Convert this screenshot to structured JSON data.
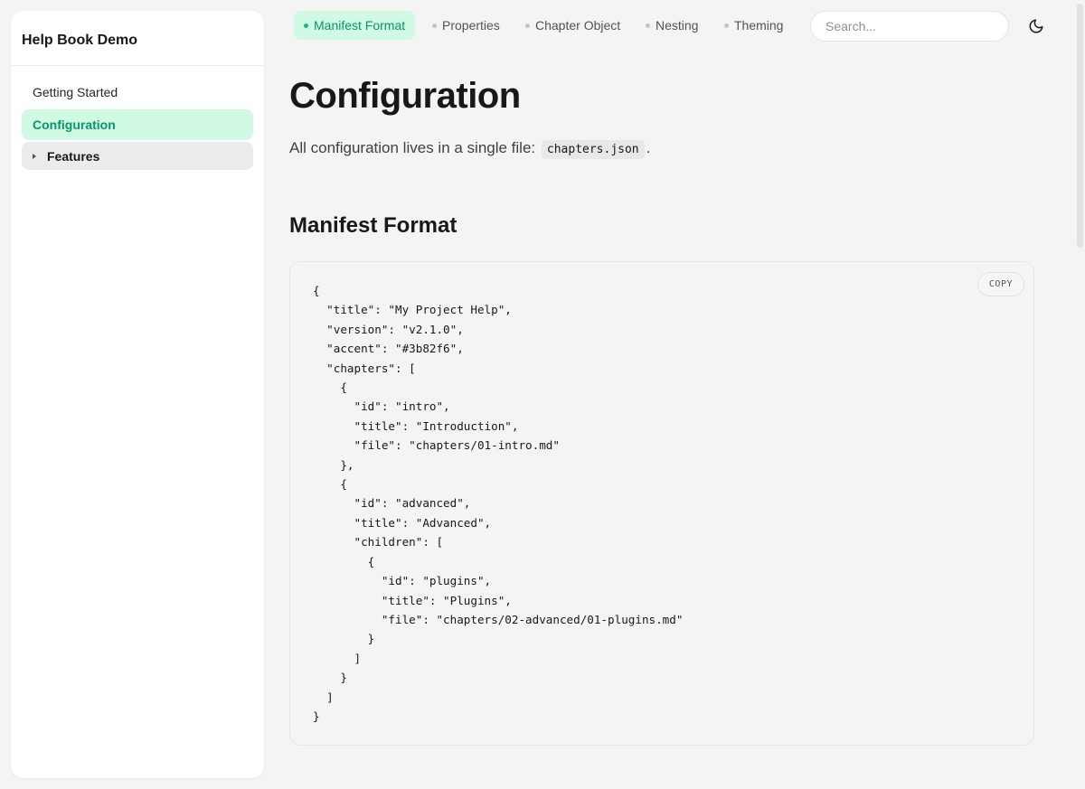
{
  "sidebar": {
    "title": "Help Book Demo",
    "items": [
      {
        "label": "Getting Started"
      },
      {
        "label": "Configuration"
      },
      {
        "label": "Features"
      }
    ]
  },
  "topbar": {
    "tabs": [
      {
        "label": "Manifest Format"
      },
      {
        "label": "Properties"
      },
      {
        "label": "Chapter Object"
      },
      {
        "label": "Nesting"
      },
      {
        "label": "Theming"
      }
    ],
    "search_placeholder": "Search...",
    "theme_icon": "moon-icon"
  },
  "main": {
    "title": "Configuration",
    "intro_text": "All configuration lives in a single file:",
    "intro_code": "chapters.json",
    "intro_end": ".",
    "section_title": "Manifest Format",
    "copy_label": "COPY",
    "code": "{\n  \"title\": \"My Project Help\",\n  \"version\": \"v2.1.0\",\n  \"accent\": \"#3b82f6\",\n  \"chapters\": [\n    {\n      \"id\": \"intro\",\n      \"title\": \"Introduction\",\n      \"file\": \"chapters/01-intro.md\"\n    },\n    {\n      \"id\": \"advanced\",\n      \"title\": \"Advanced\",\n      \"children\": [\n        {\n          \"id\": \"plugins\",\n          \"title\": \"Plugins\",\n          \"file\": \"chapters/02-advanced/01-plugins.md\"\n        }\n      ]\n    }\n  ]\n}"
  },
  "colors": {
    "accent": "#059669",
    "accent_bg": "#d1fae5",
    "background": "#f4f4f5"
  }
}
